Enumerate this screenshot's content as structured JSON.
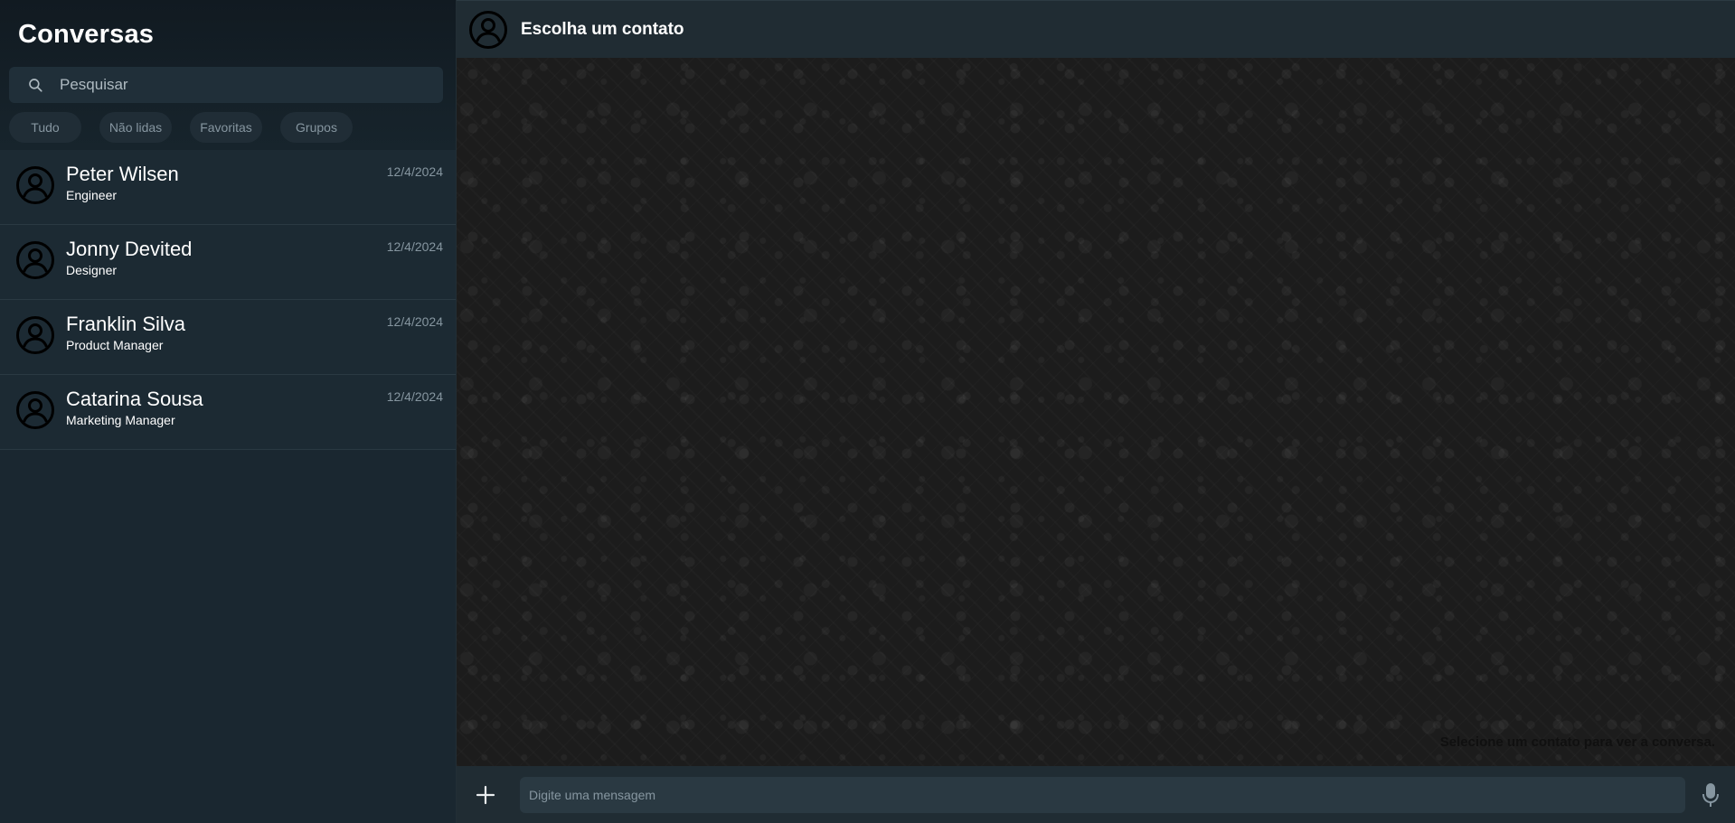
{
  "sidebar": {
    "title": "Conversas",
    "search": {
      "placeholder": "Pesquisar",
      "value": ""
    },
    "filters": [
      "Tudo",
      "Não lidas",
      "Favoritas",
      "Grupos"
    ],
    "conversations": [
      {
        "name": "Peter Wilsen",
        "subtitle": "Engineer",
        "date": "12/4/2024"
      },
      {
        "name": "Jonny Devited",
        "subtitle": "Designer",
        "date": "12/4/2024"
      },
      {
        "name": "Franklin Silva",
        "subtitle": "Product Manager",
        "date": "12/4/2024"
      },
      {
        "name": "Catarina Sousa",
        "subtitle": "Marketing Manager",
        "date": "12/4/2024"
      }
    ]
  },
  "chat": {
    "header_title": "Escolha um contato",
    "empty_hint": "Selecione um contato para ver a conversa.",
    "composer": {
      "placeholder": "Digite uma mensagem",
      "value": ""
    }
  },
  "icons": {
    "avatar": "user-circle-icon",
    "search": "search-icon",
    "attach": "plus-icon",
    "mic": "microphone-icon"
  },
  "colors": {
    "sidebar_bg": "#1a2730",
    "header_bg": "#202c33",
    "chat_bg": "#1c1c1c",
    "muted_text": "#8696a0"
  }
}
